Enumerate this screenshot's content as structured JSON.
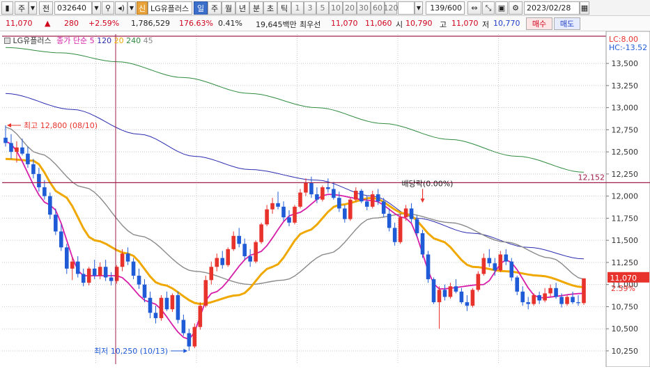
{
  "toolbar": {
    "market": "주",
    "all": "전",
    "code": "032640",
    "stock_badge": "신",
    "stock_name": "LG유플러스",
    "periods": [
      "일",
      "주",
      "월",
      "년",
      "분",
      "초",
      "틱"
    ],
    "active_period": "일",
    "intervals": [
      "1",
      "3",
      "5",
      "10",
      "20",
      "30",
      "60",
      "120"
    ],
    "count": "139/600",
    "date": "2023/02/28"
  },
  "pricebar": {
    "price": "11,070",
    "change": "280",
    "change_pct": "+2.59%",
    "volume": "1,786,529",
    "vol_ratio": "176.63%",
    "turnover": "0.41%",
    "amount": "19,645백만",
    "best_ask_label": "최우선",
    "best_ask": "11,070",
    "best_bid": "11,060",
    "open_label": "시",
    "open": "10,790",
    "high_label": "고",
    "high": "11,070",
    "low_label": "저",
    "low": "10,770",
    "buy": "매수",
    "sell": "매도"
  },
  "legend": {
    "name": "LG유플러스",
    "ma_label": "종가 단순",
    "ma_periods": [
      "5",
      "120",
      "20",
      "240",
      "45"
    ]
  },
  "annotations": {
    "high": "최고 12,800 (08/10)",
    "low": "최저 10,250 (10/13)",
    "dividend": "배당락(0.00%)",
    "hline": "12,152"
  },
  "right_axis": {
    "lc": "LC:8.00",
    "hc": "HC:-13.52",
    "price_box": "11,070",
    "pct_box": "2.59%",
    "ticks": [
      "13,500",
      "13,250",
      "13,000",
      "12,750",
      "12,500",
      "12,250",
      "12,000",
      "11,750",
      "11,500",
      "11,250",
      "11,000",
      "10,750",
      "10,500",
      "10,250"
    ]
  },
  "colors": {
    "up": "#e8322c",
    "down": "#1f5bd6",
    "ma5": "#d61ea8",
    "ma20": "#f0a800",
    "ma45": "#8a8a8a",
    "ma120": "#2a2ab0",
    "ma240": "#2e8b3e"
  },
  "chart_data": {
    "type": "candlestick",
    "ylim": [
      10100,
      13800
    ],
    "hline": 12152,
    "ohlc": [
      [
        12660,
        12800,
        12560,
        12600
      ],
      [
        12600,
        12700,
        12420,
        12500
      ],
      [
        12500,
        12620,
        12380,
        12550
      ],
      [
        12550,
        12650,
        12460,
        12480
      ],
      [
        12480,
        12560,
        12320,
        12360
      ],
      [
        12360,
        12420,
        12200,
        12250
      ],
      [
        12250,
        12320,
        12050,
        12100
      ],
      [
        12100,
        12180,
        11960,
        12000
      ],
      [
        12000,
        12040,
        11740,
        11790
      ],
      [
        11790,
        11860,
        11560,
        11600
      ],
      [
        11600,
        11680,
        11380,
        11420
      ],
      [
        11420,
        11460,
        11120,
        11180
      ],
      [
        11180,
        11300,
        11050,
        11260
      ],
      [
        11260,
        11320,
        11080,
        11120
      ],
      [
        11120,
        11180,
        10980,
        11020
      ],
      [
        11020,
        11200,
        10990,
        11180
      ],
      [
        11180,
        11280,
        11060,
        11100
      ],
      [
        11100,
        11250,
        11060,
        11200
      ],
      [
        11200,
        11280,
        11040,
        11080
      ],
      [
        11080,
        11140,
        10990,
        11040
      ],
      [
        11040,
        11220,
        11010,
        11200
      ],
      [
        11200,
        11400,
        11150,
        11350
      ],
      [
        11350,
        11420,
        11220,
        11260
      ],
      [
        11260,
        11300,
        11060,
        11100
      ],
      [
        11100,
        11180,
        10950,
        11000
      ],
      [
        11000,
        11060,
        10800,
        10850
      ],
      [
        10850,
        10920,
        10620,
        10680
      ],
      [
        10680,
        10760,
        10560,
        10620
      ],
      [
        10620,
        10880,
        10590,
        10850
      ],
      [
        10850,
        10920,
        10700,
        10720
      ],
      [
        10720,
        10900,
        10690,
        10880
      ],
      [
        10880,
        10920,
        10560,
        10600
      ],
      [
        10600,
        10660,
        10420,
        10450
      ],
      [
        10450,
        10500,
        10250,
        10300
      ],
      [
        10300,
        10560,
        10280,
        10520
      ],
      [
        10520,
        10800,
        10490,
        10760
      ],
      [
        10760,
        11100,
        10740,
        11050
      ],
      [
        11050,
        11260,
        11000,
        11200
      ],
      [
        11200,
        11350,
        11150,
        11300
      ],
      [
        11300,
        11380,
        11180,
        11220
      ],
      [
        11220,
        11420,
        11200,
        11400
      ],
      [
        11400,
        11600,
        11380,
        11550
      ],
      [
        11550,
        11640,
        11420,
        11460
      ],
      [
        11460,
        11520,
        11280,
        11320
      ],
      [
        11320,
        11400,
        11200,
        11260
      ],
      [
        11260,
        11500,
        11240,
        11480
      ],
      [
        11480,
        11700,
        11460,
        11680
      ],
      [
        11680,
        11900,
        11660,
        11850
      ],
      [
        11850,
        11980,
        11800,
        11920
      ],
      [
        11920,
        12050,
        11850,
        11880
      ],
      [
        11880,
        11940,
        11720,
        11760
      ],
      [
        11760,
        11840,
        11660,
        11700
      ],
      [
        11700,
        11900,
        11680,
        11880
      ],
      [
        11880,
        12080,
        11860,
        12040
      ],
      [
        12040,
        12200,
        12000,
        12150
      ],
      [
        12150,
        12220,
        11980,
        12020
      ],
      [
        12020,
        12100,
        11920,
        11960
      ],
      [
        11960,
        12120,
        11940,
        12100
      ],
      [
        12100,
        12200,
        12040,
        12080
      ],
      [
        12080,
        12160,
        11960,
        11980
      ],
      [
        11980,
        12050,
        11820,
        11860
      ],
      [
        11860,
        11900,
        11700,
        11740
      ],
      [
        11740,
        11980,
        11720,
        11960
      ],
      [
        11960,
        12100,
        11940,
        12060
      ],
      [
        12060,
        12080,
        11920,
        11940
      ],
      [
        11940,
        12000,
        11840,
        11880
      ],
      [
        11880,
        12060,
        11860,
        12020
      ],
      [
        12020,
        12080,
        11900,
        11940
      ],
      [
        11940,
        11980,
        11760,
        11800
      ],
      [
        11800,
        11860,
        11600,
        11640
      ],
      [
        11640,
        11700,
        11440,
        11480
      ],
      [
        11480,
        11800,
        11460,
        11760
      ],
      [
        11760,
        11900,
        11720,
        11860
      ],
      [
        11860,
        11920,
        11700,
        11740
      ],
      [
        11740,
        11780,
        11540,
        11580
      ],
      [
        11580,
        11620,
        11300,
        11340
      ],
      [
        11340,
        11380,
        11020,
        11060
      ],
      [
        11060,
        11080,
        10780,
        10800
      ],
      [
        10800,
        10980,
        10500,
        10940
      ],
      [
        10940,
        11000,
        10820,
        10860
      ],
      [
        10860,
        11020,
        10840,
        10980
      ],
      [
        10980,
        11060,
        10900,
        10920
      ],
      [
        10920,
        10960,
        10780,
        10800
      ],
      [
        10800,
        10880,
        10700,
        10760
      ],
      [
        10760,
        10960,
        10740,
        10940
      ],
      [
        10940,
        11150,
        10920,
        11120
      ],
      [
        11120,
        11350,
        11100,
        11300
      ],
      [
        11300,
        11400,
        11200,
        11240
      ],
      [
        11240,
        11300,
        11100,
        11160
      ],
      [
        11160,
        11380,
        11140,
        11340
      ],
      [
        11340,
        11400,
        11220,
        11260
      ],
      [
        11260,
        11300,
        11040,
        11080
      ],
      [
        11080,
        11100,
        10880,
        10920
      ],
      [
        10920,
        10980,
        10760,
        10800
      ],
      [
        10800,
        10860,
        10720,
        10780
      ],
      [
        10780,
        10900,
        10760,
        10880
      ],
      [
        10880,
        10920,
        10780,
        10820
      ],
      [
        10820,
        10960,
        10800,
        10900
      ],
      [
        10900,
        11000,
        10860,
        10960
      ],
      [
        10960,
        11020,
        10840,
        10860
      ],
      [
        10860,
        10900,
        10740,
        10780
      ],
      [
        10780,
        10880,
        10760,
        10860
      ],
      [
        10860,
        10920,
        10780,
        10800
      ],
      [
        10800,
        10880,
        10760,
        10790
      ],
      [
        10790,
        11070,
        10770,
        11070
      ]
    ],
    "ma_anchors": {
      "ma5": [
        [
          0,
          12620
        ],
        [
          8,
          11900
        ],
        [
          14,
          11100
        ],
        [
          20,
          11100
        ],
        [
          26,
          10800
        ],
        [
          33,
          10380
        ],
        [
          37,
          10900
        ],
        [
          45,
          11350
        ],
        [
          52,
          11800
        ],
        [
          58,
          12020
        ],
        [
          66,
          11950
        ],
        [
          72,
          11750
        ],
        [
          78,
          10950
        ],
        [
          86,
          11000
        ],
        [
          90,
          11280
        ],
        [
          96,
          10850
        ],
        [
          104,
          10900
        ]
      ],
      "ma20": [
        [
          0,
          12420
        ],
        [
          5,
          12400
        ],
        [
          10,
          12020
        ],
        [
          16,
          11500
        ],
        [
          22,
          11350
        ],
        [
          28,
          11000
        ],
        [
          35,
          10780
        ],
        [
          42,
          10880
        ],
        [
          48,
          11200
        ],
        [
          54,
          11600
        ],
        [
          60,
          11900
        ],
        [
          66,
          11980
        ],
        [
          72,
          11800
        ],
        [
          78,
          11500
        ],
        [
          84,
          11200
        ],
        [
          90,
          11150
        ],
        [
          96,
          11100
        ],
        [
          104,
          10970
        ]
      ],
      "ma45": [
        [
          0,
          12780
        ],
        [
          6,
          12480
        ],
        [
          14,
          12100
        ],
        [
          24,
          11550
        ],
        [
          34,
          11150
        ],
        [
          44,
          11000
        ],
        [
          50,
          11050
        ],
        [
          58,
          11350
        ],
        [
          66,
          11750
        ],
        [
          72,
          11800
        ],
        [
          80,
          11700
        ],
        [
          90,
          11480
        ],
        [
          98,
          11300
        ],
        [
          104,
          11060
        ]
      ],
      "ma120": [
        [
          0,
          13160
        ],
        [
          12,
          12980
        ],
        [
          24,
          12700
        ],
        [
          34,
          12450
        ],
        [
          44,
          12300
        ],
        [
          56,
          12180
        ],
        [
          66,
          12000
        ],
        [
          74,
          11750
        ],
        [
          84,
          11580
        ],
        [
          94,
          11420
        ],
        [
          104,
          11290
        ]
      ],
      "ma240": [
        [
          0,
          13680
        ],
        [
          10,
          13620
        ],
        [
          20,
          13520
        ],
        [
          32,
          13340
        ],
        [
          44,
          13160
        ],
        [
          56,
          13000
        ],
        [
          68,
          12820
        ],
        [
          80,
          12640
        ],
        [
          92,
          12450
        ],
        [
          104,
          12270
        ]
      ]
    }
  }
}
